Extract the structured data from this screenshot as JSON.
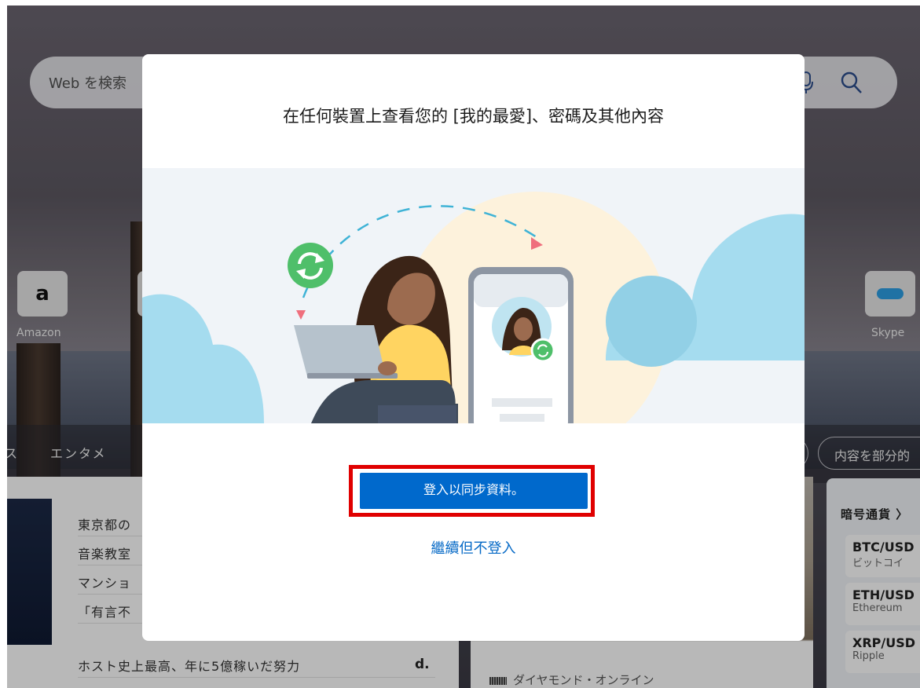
{
  "background": {
    "search": {
      "placeholder": "Web を検索"
    },
    "quick_links": [
      {
        "label": "Amazon",
        "icon": "amazon-icon"
      },
      {
        "label": "Skype",
        "icon": "skype-icon"
      }
    ],
    "nav": {
      "category": "エンタメ",
      "partial_button": "内容を部分的"
    },
    "news": {
      "items": [
        "東京都の",
        "音楽教室",
        "マンショ",
        "「有言不",
        "ホスト史上最高、年に5億稼いだ努力"
      ],
      "source_logo": "d."
    },
    "photo_card": {
      "source": "ダイヤモンド・オンライン"
    },
    "crypto": {
      "title": "暗号通貨 〉",
      "rows": [
        {
          "symbol": "BTC/USD",
          "name": "ビットコイ"
        },
        {
          "symbol": "ETH/USD",
          "name": "Ethereum"
        },
        {
          "symbol": "XRP/USD",
          "name": "Ripple"
        }
      ]
    }
  },
  "modal": {
    "title": "在任何裝置上查看您的 [我的最愛]、密碼及其他內容",
    "sync_button": "登入以同步資料。",
    "continue_link": "繼續但不登入"
  },
  "colors": {
    "primary_button": "#0069cc",
    "highlight_border": "#e00000",
    "link": "#0569c6",
    "sync_icon": "#4fbf6a",
    "cloud": "#a5dcef",
    "sweater": "#ffd461"
  }
}
